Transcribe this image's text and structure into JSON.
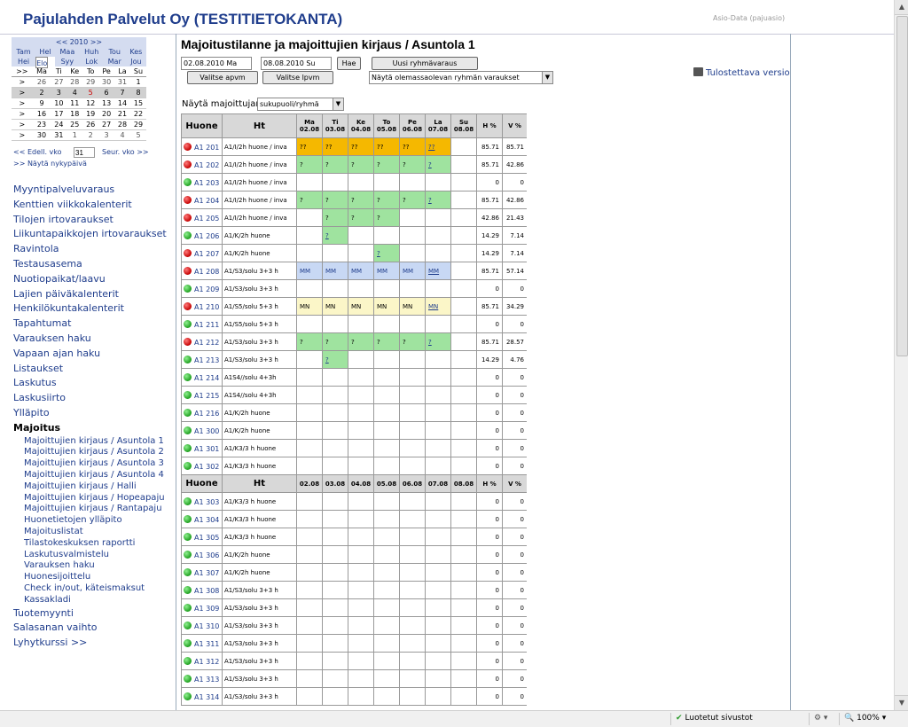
{
  "header": {
    "title": "Pajulahden Palvelut Oy (TESTITIETOKANTA)",
    "org": "Asio-Data (pajuasio)"
  },
  "calendar": {
    "nav": "<< 2010 >>",
    "months_row1": [
      "Tam",
      "Hel",
      "Maa",
      "Huh",
      "Tou",
      "Kes"
    ],
    "months_row2": [
      "Hei",
      "Elo",
      "Syy",
      "Lok",
      "Mar",
      "Jou"
    ],
    "selected_month": "Elo",
    "weekdays": [
      ">>",
      "Ma",
      "Ti",
      "Ke",
      "To",
      "Pe",
      "La",
      "Su"
    ],
    "weeks": [
      [
        ">",
        "26",
        "27",
        "28",
        "29",
        "30",
        "31",
        "1"
      ],
      [
        ">",
        "2",
        "3",
        "4",
        "5",
        "6",
        "7",
        "8"
      ],
      [
        ">",
        "9",
        "10",
        "11",
        "12",
        "13",
        "14",
        "15"
      ],
      [
        ">",
        "16",
        "17",
        "18",
        "19",
        "20",
        "21",
        "22"
      ],
      [
        ">",
        "23",
        "24",
        "25",
        "26",
        "27",
        "28",
        "29"
      ],
      [
        ">",
        "30",
        "31",
        "1",
        "2",
        "3",
        "4",
        "5"
      ]
    ],
    "prev_week": "<< Edell. vko",
    "week_number": "31",
    "next_week": "Seur. vko >>",
    "show_today": ">> Näytä nykypäivä"
  },
  "menu": {
    "items": [
      "Myyntipalveluvaraus",
      "Kenttien viikkokalenterit",
      "Tilojen irtovaraukset",
      "Liikuntapaikkojen irtovaraukset",
      "Ravintola",
      "Testausasema",
      "Nuotiopaikat/laavu",
      "Lajien päiväkalenterit",
      "Henkilökuntakalenterit",
      "Tapahtumat",
      "Varauksen haku",
      "Vapaan ajan haku",
      "Listaukset",
      "Laskutus",
      "Laskusiirto",
      "Ylläpito"
    ],
    "active": "Majoitus",
    "subitems": [
      "Majoittujien kirjaus / Asuntola 1",
      "Majoittujien kirjaus / Asuntola 2",
      "Majoittujien kirjaus / Asuntola 3",
      "Majoittujien kirjaus / Asuntola 4",
      "Majoittujien kirjaus / Halli",
      "Majoittujien kirjaus / Hopeapaju",
      "Majoittujien kirjaus / Rantapaju",
      "Huonetietojen ylläpito",
      "Majoituslistat",
      "Tilastokeskuksen raportti",
      "Laskutusvalmistelu",
      "Varauksen haku",
      "Huonesijoittelu",
      "Check in/out, käteismaksut",
      "Kassakladi"
    ],
    "after": [
      "Tuotemyynti",
      "Salasanan vaihto",
      "Lyhytkurssi >>"
    ]
  },
  "main": {
    "title": "Majoitustilanne ja majoittujien kirjaus / Asuntola 1",
    "date_from": "02.08.2010 Ma",
    "date_to": "08.08.2010 Su",
    "search_btn": "Hae",
    "new_group_btn": "Uusi ryhmävaraus",
    "pick_start_btn": "Valitse apvm",
    "pick_end_btn": "Valitse lpvm",
    "group_select": "Näytä olemassaolevan ryhmän varaukset",
    "print_link": "Tulostettava versio",
    "show_label": "Näytä majoittujan",
    "show_select": "sukupuoli/ryhmä"
  },
  "grid": {
    "col_room": "Huone",
    "col_ht": "Ht",
    "days": [
      {
        "d": "Ma",
        "dt": "02.08"
      },
      {
        "d": "Ti",
        "dt": "03.08"
      },
      {
        "d": "Ke",
        "dt": "04.08"
      },
      {
        "d": "To",
        "dt": "05.08"
      },
      {
        "d": "Pe",
        "dt": "06.08"
      },
      {
        "d": "La",
        "dt": "07.08"
      },
      {
        "d": "Su",
        "dt": "08.08"
      }
    ],
    "col_h": "H %",
    "col_v": "V %",
    "rows": [
      {
        "room": "A1 201",
        "status": "red",
        "ht": "A1/I/2h huone / inva",
        "cells": [
          "??",
          "??",
          "??",
          "??",
          "??",
          "??",
          ""
        ],
        "colors": [
          "orange",
          "orange",
          "orange",
          "orange",
          "orange",
          "orange",
          "white"
        ],
        "h": "85.71",
        "v": "85.71"
      },
      {
        "room": "A1 202",
        "status": "red",
        "ht": "A1/I/2h huone / inva",
        "cells": [
          "?",
          "?",
          "?",
          "?",
          "?",
          "?",
          ""
        ],
        "colors": [
          "green",
          "green",
          "green",
          "green",
          "green",
          "green",
          "white"
        ],
        "h": "85.71",
        "v": "42.86"
      },
      {
        "room": "A1 203",
        "status": "green",
        "ht": "A1/I/2h huone / inva",
        "cells": [
          "",
          "",
          "",
          "",
          "",
          "",
          ""
        ],
        "colors": [
          "white",
          "white",
          "white",
          "white",
          "white",
          "white",
          "white"
        ],
        "h": "0",
        "v": "0"
      },
      {
        "room": "A1 204",
        "status": "red",
        "ht": "A1/I/2h huone / inva",
        "cells": [
          "?",
          "?",
          "?",
          "?",
          "?",
          "?",
          ""
        ],
        "colors": [
          "green",
          "green",
          "green",
          "green",
          "green",
          "green",
          "white"
        ],
        "h": "85.71",
        "v": "42.86"
      },
      {
        "room": "A1 205",
        "status": "red",
        "ht": "A1/I/2h huone / inva",
        "cells": [
          "",
          "?",
          "?",
          "?",
          "",
          "",
          ""
        ],
        "colors": [
          "white",
          "green",
          "green",
          "green",
          "white",
          "white",
          "white"
        ],
        "h": "42.86",
        "v": "21.43"
      },
      {
        "room": "A1 206",
        "status": "green",
        "ht": "A1/K/2h huone",
        "cells": [
          "",
          "?",
          "",
          "",
          "",
          "",
          ""
        ],
        "colors": [
          "white",
          "green",
          "white",
          "white",
          "white",
          "white",
          "white"
        ],
        "h": "14.29",
        "v": "7.14"
      },
      {
        "room": "A1 207",
        "status": "red",
        "ht": "A1/K/2h huone",
        "cells": [
          "",
          "",
          "",
          "?",
          "",
          "",
          ""
        ],
        "colors": [
          "white",
          "white",
          "white",
          "green",
          "white",
          "white",
          "white"
        ],
        "h": "14.29",
        "v": "7.14"
      },
      {
        "room": "A1 208",
        "status": "red",
        "ht": "A1/S3/solu 3+3 h",
        "cells": [
          "MM",
          "MM",
          "MM",
          "MM",
          "MM",
          "MM",
          ""
        ],
        "colors": [
          "blue",
          "blue",
          "blue",
          "blue",
          "blue",
          "blue",
          "white"
        ],
        "h": "85.71",
        "v": "57.14"
      },
      {
        "room": "A1 209",
        "status": "green",
        "ht": "A1/S3/solu 3+3 h",
        "cells": [
          "",
          "",
          "",
          "",
          "",
          "",
          ""
        ],
        "colors": [
          "white",
          "white",
          "white",
          "white",
          "white",
          "white",
          "white"
        ],
        "h": "0",
        "v": "0"
      },
      {
        "room": "A1 210",
        "status": "red",
        "ht": "A1/S5/solu 5+3 h",
        "cells": [
          "MN",
          "MN",
          "MN",
          "MN",
          "MN",
          "MN",
          ""
        ],
        "colors": [
          "yellow",
          "yellow",
          "yellow",
          "yellow",
          "yellow",
          "yellow",
          "white"
        ],
        "h": "85.71",
        "v": "34.29"
      },
      {
        "room": "A1 211",
        "status": "green",
        "ht": "A1/S5/solu 5+3 h",
        "cells": [
          "",
          "",
          "",
          "",
          "",
          "",
          ""
        ],
        "colors": [
          "white",
          "white",
          "white",
          "white",
          "white",
          "white",
          "white"
        ],
        "h": "0",
        "v": "0"
      },
      {
        "room": "A1 212",
        "status": "red",
        "ht": "A1/S3/solu 3+3 h",
        "cells": [
          "?",
          "?",
          "?",
          "?",
          "?",
          "?",
          ""
        ],
        "colors": [
          "green",
          "green",
          "green",
          "green",
          "green",
          "green",
          "white"
        ],
        "h": "85.71",
        "v": "28.57"
      },
      {
        "room": "A1 213",
        "status": "green",
        "ht": "A1/S3/solu 3+3 h",
        "cells": [
          "",
          "?",
          "",
          "",
          "",
          "",
          ""
        ],
        "colors": [
          "white",
          "green",
          "white",
          "white",
          "white",
          "white",
          "white"
        ],
        "h": "14.29",
        "v": "4.76"
      },
      {
        "room": "A1 214",
        "status": "green",
        "ht": "A1S4//solu 4+3h",
        "cells": [
          "",
          "",
          "",
          "",
          "",
          "",
          ""
        ],
        "colors": [
          "white",
          "white",
          "white",
          "white",
          "white",
          "white",
          "white"
        ],
        "h": "0",
        "v": "0"
      },
      {
        "room": "A1 215",
        "status": "green",
        "ht": "A1S4//solu 4+3h",
        "cells": [
          "",
          "",
          "",
          "",
          "",
          "",
          ""
        ],
        "colors": [
          "white",
          "white",
          "white",
          "white",
          "white",
          "white",
          "white"
        ],
        "h": "0",
        "v": "0"
      },
      {
        "room": "A1 216",
        "status": "green",
        "ht": "A1/K/2h huone",
        "cells": [
          "",
          "",
          "",
          "",
          "",
          "",
          ""
        ],
        "colors": [
          "white",
          "white",
          "white",
          "white",
          "white",
          "white",
          "white"
        ],
        "h": "0",
        "v": "0"
      },
      {
        "room": "A1 300",
        "status": "green",
        "ht": "A1/K/2h huone",
        "cells": [
          "",
          "",
          "",
          "",
          "",
          "",
          ""
        ],
        "colors": [
          "white",
          "white",
          "white",
          "white",
          "white",
          "white",
          "white"
        ],
        "h": "0",
        "v": "0"
      },
      {
        "room": "A1 301",
        "status": "green",
        "ht": "A1/K3/3 h huone",
        "cells": [
          "",
          "",
          "",
          "",
          "",
          "",
          ""
        ],
        "colors": [
          "white",
          "white",
          "white",
          "white",
          "white",
          "white",
          "white"
        ],
        "h": "0",
        "v": "0"
      },
      {
        "room": "A1 302",
        "status": "green",
        "ht": "A1/K3/3 h huone",
        "cells": [
          "",
          "",
          "",
          "",
          "",
          "",
          ""
        ],
        "colors": [
          "white",
          "white",
          "white",
          "white",
          "white",
          "white",
          "white"
        ],
        "h": "0",
        "v": "0"
      }
    ],
    "rows2": [
      {
        "room": "A1 303",
        "status": "green",
        "ht": "A1/K3/3 h huone",
        "h": "0",
        "v": "0"
      },
      {
        "room": "A1 304",
        "status": "green",
        "ht": "A1/K3/3 h huone",
        "h": "0",
        "v": "0"
      },
      {
        "room": "A1 305",
        "status": "green",
        "ht": "A1/K3/3 h huone",
        "h": "0",
        "v": "0"
      },
      {
        "room": "A1 306",
        "status": "green",
        "ht": "A1/K/2h huone",
        "h": "0",
        "v": "0"
      },
      {
        "room": "A1 307",
        "status": "green",
        "ht": "A1/K/2h huone",
        "h": "0",
        "v": "0"
      },
      {
        "room": "A1 308",
        "status": "green",
        "ht": "A1/S3/solu 3+3 h",
        "h": "0",
        "v": "0"
      },
      {
        "room": "A1 309",
        "status": "green",
        "ht": "A1/S3/solu 3+3 h",
        "h": "0",
        "v": "0"
      },
      {
        "room": "A1 310",
        "status": "green",
        "ht": "A1/S3/solu 3+3 h",
        "h": "0",
        "v": "0"
      },
      {
        "room": "A1 311",
        "status": "green",
        "ht": "A1/S3/solu 3+3 h",
        "h": "0",
        "v": "0"
      },
      {
        "room": "A1 312",
        "status": "green",
        "ht": "A1/S3/solu 3+3 h",
        "h": "0",
        "v": "0"
      },
      {
        "room": "A1 313",
        "status": "green",
        "ht": "A1/S3/solu 3+3 h",
        "h": "0",
        "v": "0"
      },
      {
        "room": "A1 314",
        "status": "green",
        "ht": "A1/S3/solu 3+3 h",
        "h": "0",
        "v": "0"
      }
    ]
  },
  "statusbar": {
    "trusted": "Luotetut sivustot",
    "zoom": "100%"
  },
  "colors": {
    "brand": "#1f3d8c",
    "orange": "#f5b800",
    "green": "#9fe39f",
    "blue": "#c8d8f4",
    "yellow": "#fbf6c8",
    "status_red": "#c40000",
    "status_green": "#1f9f1f"
  }
}
